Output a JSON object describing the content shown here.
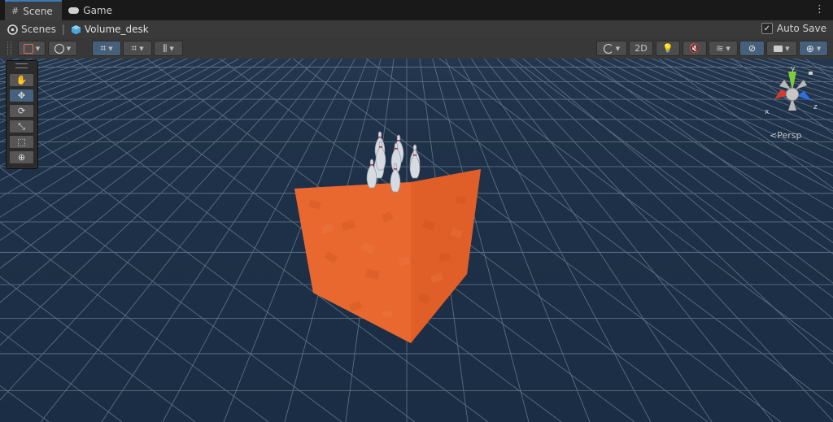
{
  "tabs": [
    {
      "label": "Scene",
      "icon": "grid-icon",
      "active": true
    },
    {
      "label": "Game",
      "icon": "gamepad-icon",
      "active": false
    }
  ],
  "tab_menu_glyph": "⋮",
  "breadcrumb": {
    "root": "Scenes",
    "current": "Volume_desk",
    "separator": "|"
  },
  "autosave": {
    "label": "Auto Save",
    "checked": true,
    "check_glyph": "✓"
  },
  "toolbar": {
    "mode_2d_label": "2D"
  },
  "tools_panel": {
    "tools": [
      {
        "name": "hand-tool",
        "glyph": "✋",
        "active": false
      },
      {
        "name": "move-tool",
        "glyph": "✥",
        "active": true
      },
      {
        "name": "rotate-tool",
        "glyph": "⟳",
        "active": false
      },
      {
        "name": "scale-tool",
        "glyph": "⤡",
        "active": false
      },
      {
        "name": "rect-tool",
        "glyph": "⬚",
        "active": false
      },
      {
        "name": "transform-tool",
        "glyph": "⊕",
        "active": false
      }
    ]
  },
  "gizmo": {
    "y_label": "y",
    "x_label": "x",
    "z_label": "z",
    "projection_label": "Persp",
    "projection_glyph": "<"
  },
  "colors": {
    "accent": "#3a79bb",
    "cube_orange": "#e8632c",
    "axis_x": "#d23a2c",
    "axis_y": "#7fcc3a",
    "axis_z": "#2f6fe0",
    "sky": "#1e3048"
  }
}
